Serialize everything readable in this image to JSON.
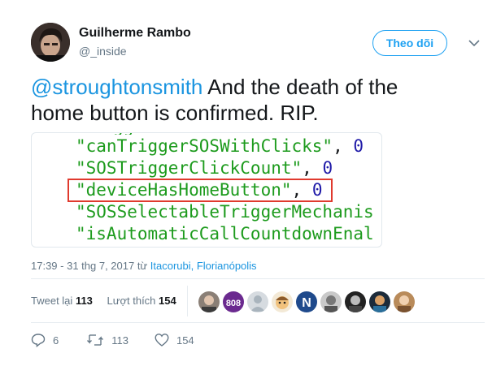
{
  "author": {
    "name": "Guilherme Rambo",
    "handle": "@_inside"
  },
  "follow_label": "Theo dõi",
  "tweet": {
    "mention": "@stroughtonsmith",
    "text": " And the death of the home button is confirmed. RIP."
  },
  "code_lines": [
    {
      "str": "\"canTriggerSOSWithClicks\"",
      "pun": ", ",
      "num": "0"
    },
    {
      "str": "\"SOSTriggerClickCount\"",
      "pun": ", ",
      "num": "0"
    },
    {
      "str": "\"deviceHasHomeButton\"",
      "pun": ", ",
      "num": "0"
    },
    {
      "str": "\"SOSSelectableTriggerMechanis",
      "pun": "",
      "num": ""
    },
    {
      "str": "\"isAutomaticCallCountdownEnal",
      "pun": "",
      "num": ""
    }
  ],
  "timestamp": "17:39 - 31 thg 7, 2017 từ ",
  "location": "Itacorubi, Florianópolis",
  "stats": {
    "retweets_label": "Tweet lại",
    "retweets": "113",
    "likes_label": "Lượt thích",
    "likes": "154"
  },
  "liker_avatars": [
    "avatar-1",
    "avatar-808",
    "avatar-default",
    "avatar-cartoon",
    "avatar-N-logo",
    "avatar-6",
    "avatar-7",
    "avatar-8",
    "avatar-9"
  ],
  "actions": {
    "replies": "6",
    "retweets": "113",
    "likes": "154"
  },
  "colors": {
    "accent": "#1da1f2",
    "string": "#1d9b1d",
    "number": "#1f1aa8",
    "highlight": "#e03a2e"
  }
}
